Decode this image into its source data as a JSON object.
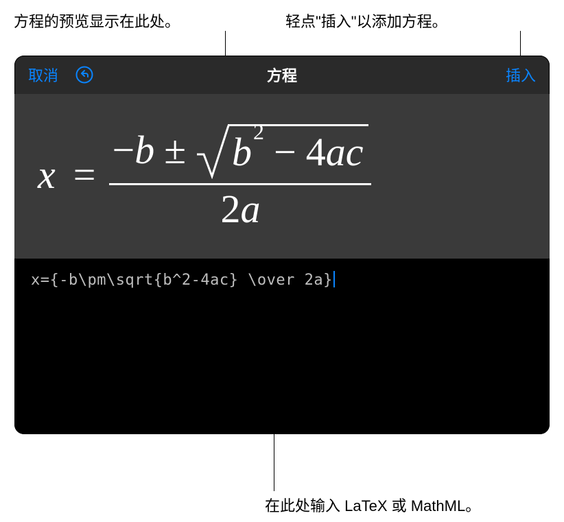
{
  "callouts": {
    "preview": "方程的预览显示在此处。",
    "insert": "轻点\"插入\"以添加方程。",
    "editor": "在此处输入 LaTeX 或 MathML。"
  },
  "toolbar": {
    "cancel": "取消",
    "title": "方程",
    "insert": "插入"
  },
  "icons": {
    "undo": "undo-icon"
  },
  "equation": {
    "latex_source": "x={-b\\pm\\sqrt{b^2-4ac} \\over 2a}",
    "parts": {
      "x": "x",
      "eq": "=",
      "minus": "−",
      "b": "b",
      "pm": "±",
      "sq": "2",
      "four": "4",
      "a": "a",
      "c": "c",
      "den2": "2",
      "denA": "a"
    }
  },
  "colors": {
    "accent": "#0a84ff",
    "dialog_bg": "#2a2a2a",
    "preview_bg": "#3a3a3a",
    "editor_bg": "#000000"
  }
}
